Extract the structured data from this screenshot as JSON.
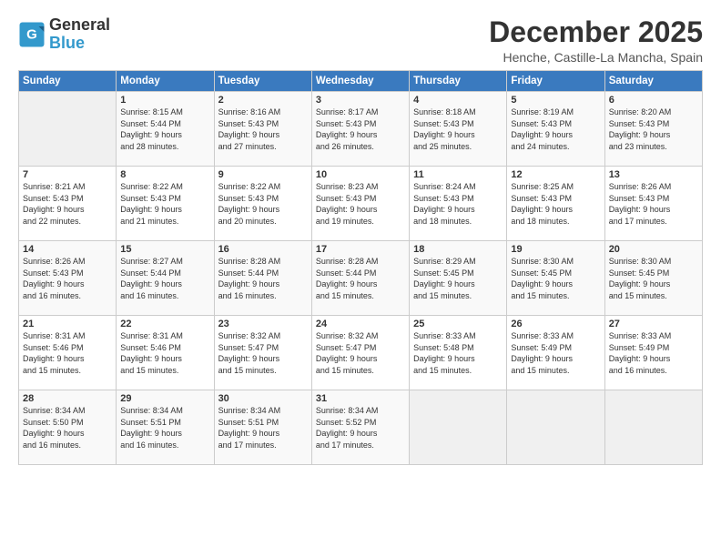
{
  "logo": {
    "line1": "General",
    "line2": "Blue"
  },
  "title": "December 2025",
  "location": "Henche, Castille-La Mancha, Spain",
  "days_of_week": [
    "Sunday",
    "Monday",
    "Tuesday",
    "Wednesday",
    "Thursday",
    "Friday",
    "Saturday"
  ],
  "weeks": [
    [
      {
        "day": "",
        "info": ""
      },
      {
        "day": "1",
        "info": "Sunrise: 8:15 AM\nSunset: 5:44 PM\nDaylight: 9 hours\nand 28 minutes."
      },
      {
        "day": "2",
        "info": "Sunrise: 8:16 AM\nSunset: 5:43 PM\nDaylight: 9 hours\nand 27 minutes."
      },
      {
        "day": "3",
        "info": "Sunrise: 8:17 AM\nSunset: 5:43 PM\nDaylight: 9 hours\nand 26 minutes."
      },
      {
        "day": "4",
        "info": "Sunrise: 8:18 AM\nSunset: 5:43 PM\nDaylight: 9 hours\nand 25 minutes."
      },
      {
        "day": "5",
        "info": "Sunrise: 8:19 AM\nSunset: 5:43 PM\nDaylight: 9 hours\nand 24 minutes."
      },
      {
        "day": "6",
        "info": "Sunrise: 8:20 AM\nSunset: 5:43 PM\nDaylight: 9 hours\nand 23 minutes."
      }
    ],
    [
      {
        "day": "7",
        "info": "Sunrise: 8:21 AM\nSunset: 5:43 PM\nDaylight: 9 hours\nand 22 minutes."
      },
      {
        "day": "8",
        "info": "Sunrise: 8:22 AM\nSunset: 5:43 PM\nDaylight: 9 hours\nand 21 minutes."
      },
      {
        "day": "9",
        "info": "Sunrise: 8:22 AM\nSunset: 5:43 PM\nDaylight: 9 hours\nand 20 minutes."
      },
      {
        "day": "10",
        "info": "Sunrise: 8:23 AM\nSunset: 5:43 PM\nDaylight: 9 hours\nand 19 minutes."
      },
      {
        "day": "11",
        "info": "Sunrise: 8:24 AM\nSunset: 5:43 PM\nDaylight: 9 hours\nand 18 minutes."
      },
      {
        "day": "12",
        "info": "Sunrise: 8:25 AM\nSunset: 5:43 PM\nDaylight: 9 hours\nand 18 minutes."
      },
      {
        "day": "13",
        "info": "Sunrise: 8:26 AM\nSunset: 5:43 PM\nDaylight: 9 hours\nand 17 minutes."
      }
    ],
    [
      {
        "day": "14",
        "info": "Sunrise: 8:26 AM\nSunset: 5:43 PM\nDaylight: 9 hours\nand 16 minutes."
      },
      {
        "day": "15",
        "info": "Sunrise: 8:27 AM\nSunset: 5:44 PM\nDaylight: 9 hours\nand 16 minutes."
      },
      {
        "day": "16",
        "info": "Sunrise: 8:28 AM\nSunset: 5:44 PM\nDaylight: 9 hours\nand 16 minutes."
      },
      {
        "day": "17",
        "info": "Sunrise: 8:28 AM\nSunset: 5:44 PM\nDaylight: 9 hours\nand 15 minutes."
      },
      {
        "day": "18",
        "info": "Sunrise: 8:29 AM\nSunset: 5:45 PM\nDaylight: 9 hours\nand 15 minutes."
      },
      {
        "day": "19",
        "info": "Sunrise: 8:30 AM\nSunset: 5:45 PM\nDaylight: 9 hours\nand 15 minutes."
      },
      {
        "day": "20",
        "info": "Sunrise: 8:30 AM\nSunset: 5:45 PM\nDaylight: 9 hours\nand 15 minutes."
      }
    ],
    [
      {
        "day": "21",
        "info": "Sunrise: 8:31 AM\nSunset: 5:46 PM\nDaylight: 9 hours\nand 15 minutes."
      },
      {
        "day": "22",
        "info": "Sunrise: 8:31 AM\nSunset: 5:46 PM\nDaylight: 9 hours\nand 15 minutes."
      },
      {
        "day": "23",
        "info": "Sunrise: 8:32 AM\nSunset: 5:47 PM\nDaylight: 9 hours\nand 15 minutes."
      },
      {
        "day": "24",
        "info": "Sunrise: 8:32 AM\nSunset: 5:47 PM\nDaylight: 9 hours\nand 15 minutes."
      },
      {
        "day": "25",
        "info": "Sunrise: 8:33 AM\nSunset: 5:48 PM\nDaylight: 9 hours\nand 15 minutes."
      },
      {
        "day": "26",
        "info": "Sunrise: 8:33 AM\nSunset: 5:49 PM\nDaylight: 9 hours\nand 15 minutes."
      },
      {
        "day": "27",
        "info": "Sunrise: 8:33 AM\nSunset: 5:49 PM\nDaylight: 9 hours\nand 16 minutes."
      }
    ],
    [
      {
        "day": "28",
        "info": "Sunrise: 8:34 AM\nSunset: 5:50 PM\nDaylight: 9 hours\nand 16 minutes."
      },
      {
        "day": "29",
        "info": "Sunrise: 8:34 AM\nSunset: 5:51 PM\nDaylight: 9 hours\nand 16 minutes."
      },
      {
        "day": "30",
        "info": "Sunrise: 8:34 AM\nSunset: 5:51 PM\nDaylight: 9 hours\nand 17 minutes."
      },
      {
        "day": "31",
        "info": "Sunrise: 8:34 AM\nSunset: 5:52 PM\nDaylight: 9 hours\nand 17 minutes."
      },
      {
        "day": "",
        "info": ""
      },
      {
        "day": "",
        "info": ""
      },
      {
        "day": "",
        "info": ""
      }
    ]
  ]
}
